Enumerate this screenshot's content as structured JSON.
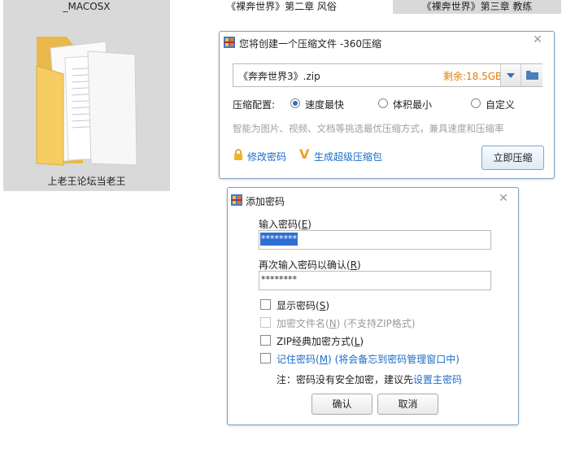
{
  "explorer": {
    "tiles": [
      {
        "label": "_MACOSX"
      },
      {
        "label": "《裸奔世界》第二章 风俗"
      },
      {
        "label": "《裸奔世界》第三章 教练"
      }
    ],
    "folder_label": "上老王论坛当老王"
  },
  "compress_dialog": {
    "title": "您将创建一个压缩文件 -360压缩",
    "filename": "《奔奔世界3》.zip",
    "remaining": "剩余:18.5GB",
    "config_label": "压缩配置:",
    "options": [
      "速度最快",
      "体积最小",
      "自定义"
    ],
    "selected": "速度最快",
    "hint": "智能为图片、视频、文档等挑选最优压缩方式，兼具速度和压缩率",
    "link_password": "修改密码",
    "link_super": "生成超级压缩包",
    "compress_button": "立即压缩"
  },
  "password_dialog": {
    "title": "添加密码",
    "enter_label": "输入密码(",
    "enter_key": "E",
    "enter_close": ")",
    "password_value": "********",
    "confirm_label": "再次输入密码以确认(",
    "confirm_key": "R",
    "confirm_close": ")",
    "confirm_value": "********",
    "show_password": "显示密码(",
    "show_key": "S",
    "show_close": ")",
    "encrypt_names": "加密文件名(",
    "encrypt_key": "N",
    "encrypt_close": ")",
    "encrypt_note": "(不支持ZIP格式)",
    "zip_classic": "ZIP经典加密方式(",
    "zip_key": "L",
    "zip_close": ")",
    "remember": "记住密码(",
    "remember_key": "M",
    "remember_close": ")",
    "remember_note": "(将会备忘到密码管理窗口中)",
    "note_text": "注：密码没有安全加密，建议先",
    "note_link": "设置主密码",
    "ok_button": "确认",
    "cancel_button": "取消"
  },
  "colors": {
    "accent": "#2b6ec9",
    "remaining": "#e07b00",
    "link": "#1a6cc8",
    "hint": "#a0a0a0"
  }
}
